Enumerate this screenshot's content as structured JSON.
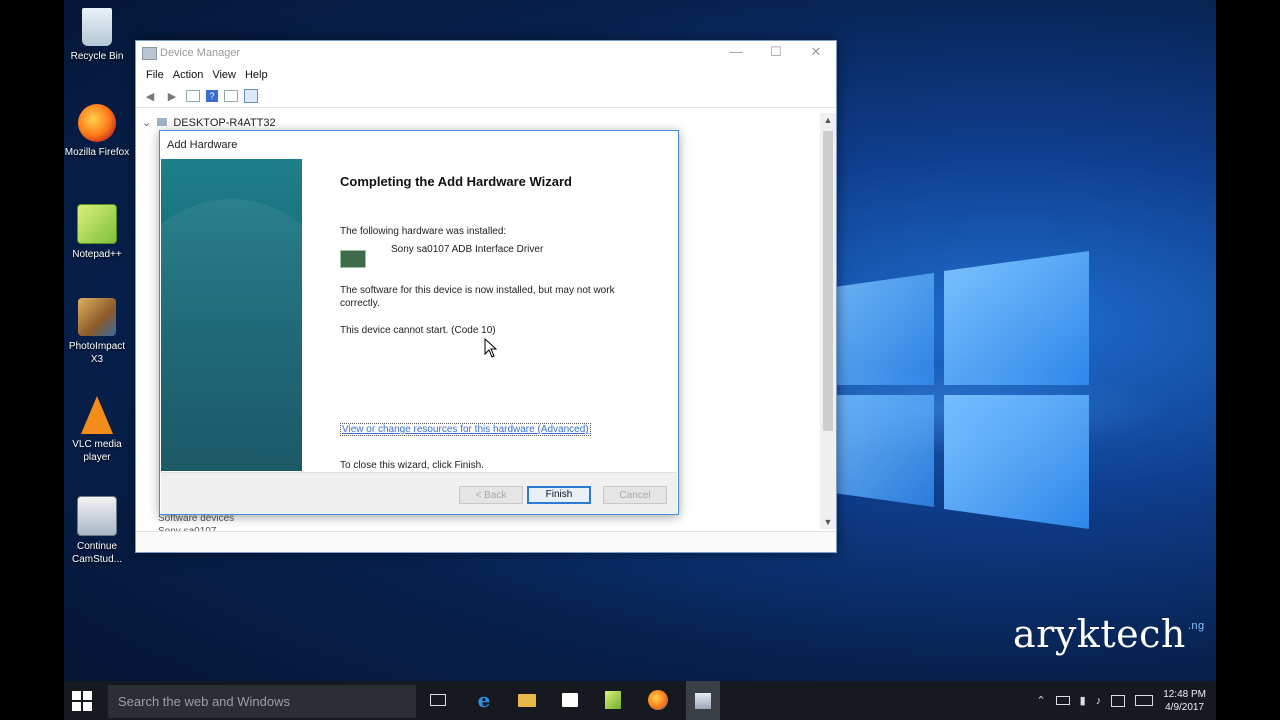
{
  "desktop": {
    "icons": [
      {
        "label": "Recycle Bin"
      },
      {
        "label": "Mozilla Firefox"
      },
      {
        "label": "Notepad++"
      },
      {
        "label": "PhotoImpact X3"
      },
      {
        "label": "VLC media player"
      },
      {
        "label": "Continue CamStud..."
      }
    ]
  },
  "device_manager": {
    "title": "Device Manager",
    "window_buttons": {
      "minimize": "—",
      "maximize": "☐",
      "close": "✕"
    },
    "menu": [
      "File",
      "Action",
      "View",
      "Help"
    ],
    "tree": {
      "root": "DESKTOP-R4ATT32",
      "partial_category": "Software devices",
      "partial_device": "Sony sa0107"
    }
  },
  "wizard": {
    "title": "Add Hardware",
    "heading": "Completing the Add Hardware Wizard",
    "installed_label": "The following hardware was installed:",
    "device_name": "Sony sa0107 ADB Interface Driver",
    "warning": "The software for this device is now installed, but may not work correctly.",
    "status": "This device cannot start. (Code 10)",
    "link": "View or change resources for this hardware (Advanced)",
    "close_hint": "To close this wizard, click Finish.",
    "buttons": {
      "back": "< Back",
      "finish": "Finish",
      "cancel": "Cancel"
    }
  },
  "watermark": {
    "text": "aryktech",
    "suffix": ".ng"
  },
  "taskbar": {
    "search_placeholder": "Search the web and Windows",
    "clock_time": "12:48 PM",
    "clock_date": "4/9/2017"
  },
  "colors": {
    "wizard_side": "#136170",
    "link": "#3a6fd0",
    "accent": "#2a7ad6"
  }
}
